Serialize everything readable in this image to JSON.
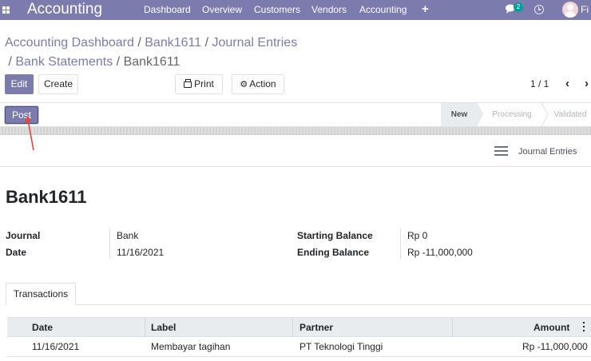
{
  "navbar": {
    "app_name": "Accounting",
    "menu": [
      "Dashboard",
      "Overview",
      "Customers",
      "Vendors",
      "Accounting"
    ],
    "plus": "+",
    "chat_count": "2",
    "user_name": "Fi",
    "colors": {
      "bar": "#7c7bad",
      "badge": "#00a09d"
    }
  },
  "breadcrumb": {
    "items": [
      "Accounting Dashboard",
      "Bank1611",
      "Journal Entries",
      "Bank Statements"
    ],
    "current": "Bank1611",
    "separator": "/"
  },
  "toolbar": {
    "edit": "Edit",
    "create": "Create",
    "print": "Print",
    "action": "Action",
    "print_icon": "printer-icon",
    "action_icon": "gear-icon"
  },
  "pager": {
    "value": "1 / 1",
    "prev": "‹",
    "next": "›"
  },
  "statusbar": {
    "post": "Post",
    "stages": [
      "New",
      "Processing",
      "Validated"
    ],
    "active_stage": "New"
  },
  "chatter": {
    "label": "Journal Entries",
    "icon": "hamburger-icon"
  },
  "record": {
    "title": "Bank1611",
    "fields": {
      "journal_label": "Journal",
      "journal_value": "Bank",
      "date_label": "Date",
      "date_value": "11/16/2021",
      "starting_balance_label": "Starting Balance",
      "starting_balance_value": "Rp 0",
      "ending_balance_label": "Ending Balance",
      "ending_balance_value": "Rp -11,000,000"
    }
  },
  "tabs": [
    "Transactions"
  ],
  "table": {
    "columns": [
      "Date",
      "Label",
      "Partner",
      "Amount"
    ],
    "rows": [
      {
        "date": "11/16/2021",
        "label": "Membayar tagihan",
        "partner": "PT Teknologi Tinggi",
        "amount": "Rp -11,000,000"
      }
    ]
  }
}
